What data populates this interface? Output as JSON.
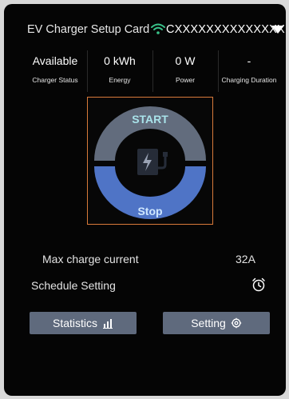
{
  "header": {
    "title": "EV Charger Setup Card",
    "device_id": "CXXXXXXXXXXXXXX"
  },
  "stats": [
    {
      "value": "Available",
      "label": "Charger Status"
    },
    {
      "value": "0 kWh",
      "label": "Energy"
    },
    {
      "value": "0 W",
      "label": "Power"
    },
    {
      "value": "-",
      "label": "Charging Duration"
    }
  ],
  "control": {
    "start_label": "START",
    "stop_label": "Stop"
  },
  "settings": {
    "max_current_label": "Max charge current",
    "max_current_value": "32A",
    "schedule_label": "Schedule Setting"
  },
  "actions": {
    "statistics_label": "Statistics",
    "setting_label": "Setting"
  },
  "colors": {
    "card_bg": "#050505",
    "accent_border": "#d87a3a",
    "start_arc": "#626c7d",
    "stop_arc": "#4f74c6",
    "wifi": "#39c38a",
    "button_bg": "#5f6a7d"
  },
  "icons": [
    "wifi-icon",
    "dropdown-triangle-icon",
    "ev-charger-icon",
    "alarm-clock-icon",
    "bar-chart-icon",
    "gear-icon"
  ]
}
